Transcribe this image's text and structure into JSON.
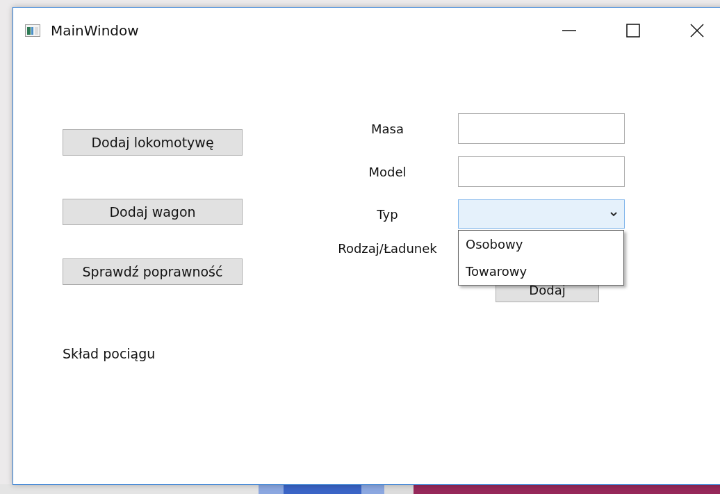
{
  "window": {
    "title": "MainWindow"
  },
  "buttons": [
    {
      "label": "Dodaj lokomotywę"
    },
    {
      "label": "Dodaj wagon"
    },
    {
      "label": "Sprawdź poprawność"
    }
  ],
  "train_label": "Skład pociągu",
  "form": {
    "fields": [
      {
        "kind": "text",
        "label": "Masa"
      },
      {
        "kind": "text",
        "label": "Model"
      },
      {
        "kind": "combo",
        "label": "Typ",
        "expanded": true,
        "options": [
          {
            "label": "Osobowy",
            "selected": false
          },
          {
            "label": "Towarowy",
            "selected": false
          }
        ]
      },
      {
        "kind": "label",
        "label": "Rodzaj/Ładunek"
      }
    ],
    "submit": "Dodaj"
  }
}
